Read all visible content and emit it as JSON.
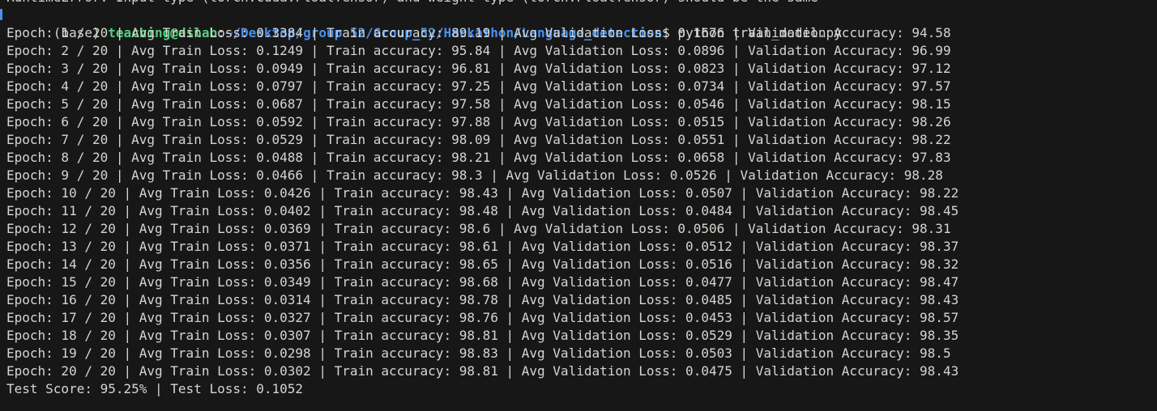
{
  "terminal": {
    "previous_output": "RuntimeError: Input type (torch.cuda.FloatTensor) and weight type (torch.FloatTensor) should be the same",
    "prompt": {
      "env": "(base) ",
      "user_host": "teaching@dslab",
      "colon": ":",
      "path": "~/Desktop/group 52/Group_52/Hackathon/Language_detection",
      "dollar": "$ ",
      "command": "python train_model.py"
    },
    "output_lines": [
      "Epoch: 1 / 20 | Avg Train Loss: 0.3384 | Train accuracy: 89.19 | Avg Validation Loss: 0.1676 | Validation Accuracy: 94.58",
      "Epoch: 2 / 20 | Avg Train Loss: 0.1249 | Train accuracy: 95.84 | Avg Validation Loss: 0.0896 | Validation Accuracy: 96.99",
      "Epoch: 3 / 20 | Avg Train Loss: 0.0949 | Train accuracy: 96.81 | Avg Validation Loss: 0.0823 | Validation Accuracy: 97.12",
      "Epoch: 4 / 20 | Avg Train Loss: 0.0797 | Train accuracy: 97.25 | Avg Validation Loss: 0.0734 | Validation Accuracy: 97.57",
      "Epoch: 5 / 20 | Avg Train Loss: 0.0687 | Train accuracy: 97.58 | Avg Validation Loss: 0.0546 | Validation Accuracy: 98.15",
      "Epoch: 6 / 20 | Avg Train Loss: 0.0592 | Train accuracy: 97.88 | Avg Validation Loss: 0.0515 | Validation Accuracy: 98.26",
      "Epoch: 7 / 20 | Avg Train Loss: 0.0529 | Train accuracy: 98.09 | Avg Validation Loss: 0.0551 | Validation Accuracy: 98.22",
      "Epoch: 8 / 20 | Avg Train Loss: 0.0488 | Train accuracy: 98.21 | Avg Validation Loss: 0.0658 | Validation Accuracy: 97.83",
      "Epoch: 9 / 20 | Avg Train Loss: 0.0466 | Train accuracy: 98.3 | Avg Validation Loss: 0.0526 | Validation Accuracy: 98.28",
      "Epoch: 10 / 20 | Avg Train Loss: 0.0426 | Train accuracy: 98.43 | Avg Validation Loss: 0.0507 | Validation Accuracy: 98.22",
      "Epoch: 11 / 20 | Avg Train Loss: 0.0402 | Train accuracy: 98.48 | Avg Validation Loss: 0.0484 | Validation Accuracy: 98.45",
      "Epoch: 12 / 20 | Avg Train Loss: 0.0369 | Train accuracy: 98.6 | Avg Validation Loss: 0.0506 | Validation Accuracy: 98.31",
      "Epoch: 13 / 20 | Avg Train Loss: 0.0371 | Train accuracy: 98.61 | Avg Validation Loss: 0.0512 | Validation Accuracy: 98.37",
      "Epoch: 14 / 20 | Avg Train Loss: 0.0356 | Train accuracy: 98.65 | Avg Validation Loss: 0.0516 | Validation Accuracy: 98.32",
      "Epoch: 15 / 20 | Avg Train Loss: 0.0349 | Train accuracy: 98.68 | Avg Validation Loss: 0.0477 | Validation Accuracy: 98.47",
      "Epoch: 16 / 20 | Avg Train Loss: 0.0314 | Train accuracy: 98.78 | Avg Validation Loss: 0.0485 | Validation Accuracy: 98.43",
      "Epoch: 17 / 20 | Avg Train Loss: 0.0327 | Train accuracy: 98.76 | Avg Validation Loss: 0.0453 | Validation Accuracy: 98.57",
      "Epoch: 18 / 20 | Avg Train Loss: 0.0307 | Train accuracy: 98.81 | Avg Validation Loss: 0.0529 | Validation Accuracy: 98.35",
      "Epoch: 19 / 20 | Avg Train Loss: 0.0298 | Train accuracy: 98.83 | Avg Validation Loss: 0.0503 | Validation Accuracy: 98.5",
      "Epoch: 20 / 20 | Avg Train Loss: 0.0302 | Train accuracy: 98.81 | Avg Validation Loss: 0.0475 | Validation Accuracy: 98.43",
      "Test Score: 95.25% | Test Loss: 0.1052"
    ],
    "colors": {
      "background": "#171717",
      "foreground": "#d3d7cf",
      "user_host": "#4fd07a",
      "path": "#4b8ff0"
    }
  }
}
